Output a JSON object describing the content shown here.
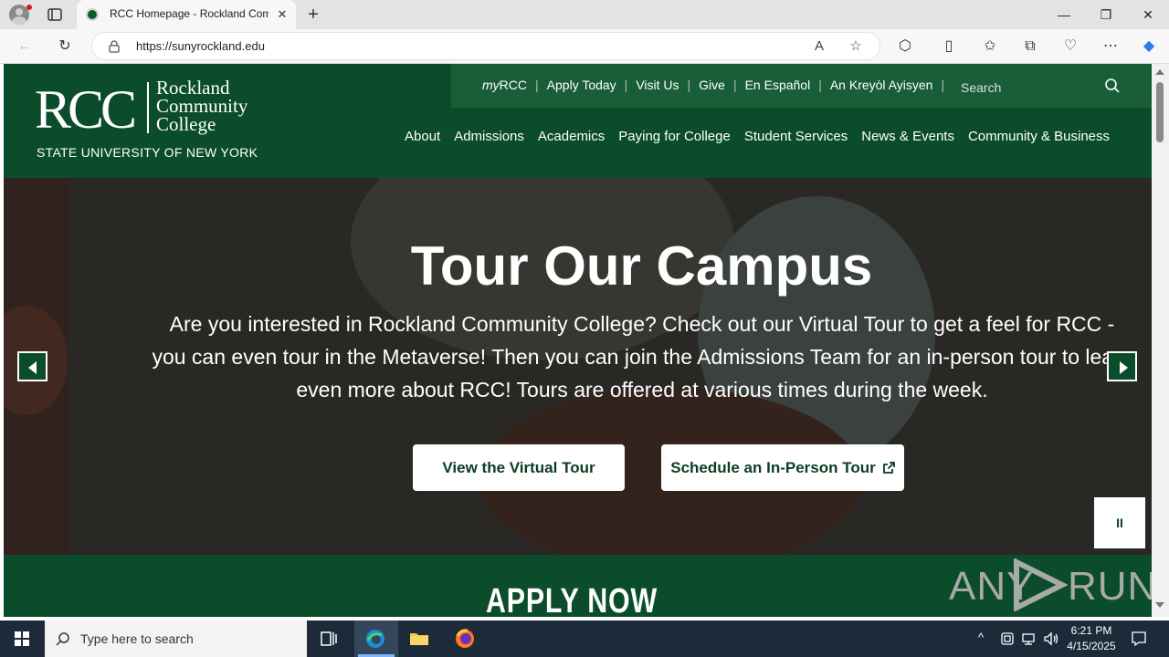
{
  "browser": {
    "tab_title": "RCC Homepage - Rockland Com",
    "url": "https://sunyrockland.edu",
    "new_tab_label": "+",
    "window_controls": {
      "minimize": "—",
      "restore": "❐",
      "close": "✕"
    }
  },
  "site": {
    "logo": {
      "mark": "RCC",
      "name_line1": "Rockland",
      "name_line2": "Community",
      "name_line3": "College",
      "subtitle": "STATE UNIVERSITY OF NEW YORK"
    },
    "utility_nav": {
      "myrcc_prefix": "my",
      "myrcc_suffix": "RCC",
      "items": [
        "Apply Today",
        "Visit Us",
        "Give",
        "En Español",
        "An Kreyòl Ayisyen"
      ],
      "search_placeholder": "Search"
    },
    "main_nav": [
      "About",
      "Admissions",
      "Academics",
      "Paying for College",
      "Student Services",
      "News & Events",
      "Community & Business"
    ],
    "hero": {
      "title": "Tour Our Campus",
      "text": "Are you interested in Rockland Community College? Check out our Virtual Tour to get a feel for RCC - you can even tour in the Metaverse! Then you can join the Admissions Team for an in-person tour to learn even more about RCC! Tours are offered at various times during the week.",
      "button_virtual": "View the Virtual Tour",
      "button_inperson": "Schedule an In-Person Tour",
      "pause_label": "II"
    },
    "apply_band": {
      "text": "APPLY NOW"
    },
    "watermark": {
      "left": "ANY",
      "right": "RUN"
    }
  },
  "taskbar": {
    "search_placeholder": "Type here to search",
    "time": "6:21 PM",
    "date": "4/15/2025"
  },
  "colors": {
    "brand_green": "#0b4d2b",
    "utility_green": "#195e38",
    "taskbar": "#1c2a3a"
  }
}
